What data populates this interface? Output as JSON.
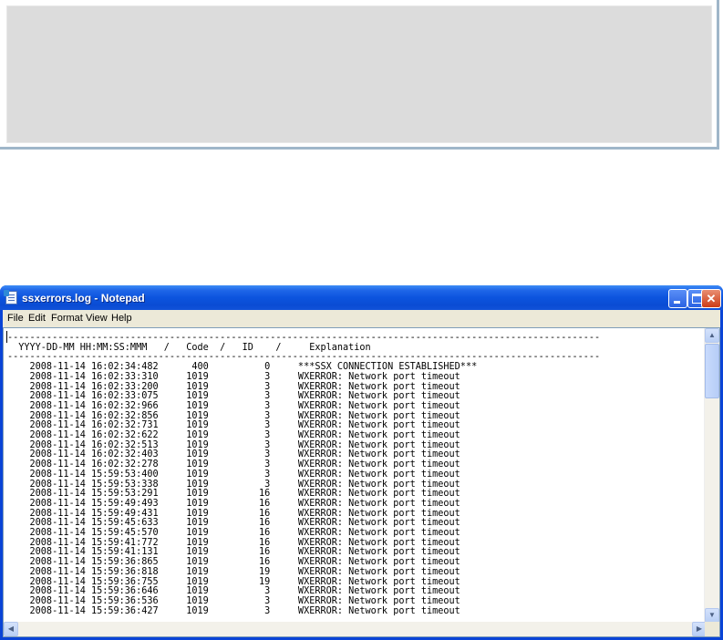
{
  "window": {
    "title": "ssxerrors.log - Notepad",
    "min_glyph": "",
    "max_glyph": "",
    "close_glyph": "✕"
  },
  "menu": [
    "File",
    "Edit",
    "Format",
    "View",
    "Help"
  ],
  "log": {
    "separator": "----------------------------------------------------------------------------------------------------------",
    "header": "  YYYY-DD-MM HH:MM:SS:MMM   /   Code  /   ID    /     Explanation",
    "rows": [
      [
        "2008-11-14",
        "16:02:34:482",
        "400",
        "0",
        "***SSX CONNECTION ESTABLISHED***"
      ],
      [
        "2008-11-14",
        "16:02:33:310",
        "1019",
        "3",
        "WXERROR: Network port timeout"
      ],
      [
        "2008-11-14",
        "16:02:33:200",
        "1019",
        "3",
        "WXERROR: Network port timeout"
      ],
      [
        "2008-11-14",
        "16:02:33:075",
        "1019",
        "3",
        "WXERROR: Network port timeout"
      ],
      [
        "2008-11-14",
        "16:02:32:966",
        "1019",
        "3",
        "WXERROR: Network port timeout"
      ],
      [
        "2008-11-14",
        "16:02:32:856",
        "1019",
        "3",
        "WXERROR: Network port timeout"
      ],
      [
        "2008-11-14",
        "16:02:32:731",
        "1019",
        "3",
        "WXERROR: Network port timeout"
      ],
      [
        "2008-11-14",
        "16:02:32:622",
        "1019",
        "3",
        "WXERROR: Network port timeout"
      ],
      [
        "2008-11-14",
        "16:02:32:513",
        "1019",
        "3",
        "WXERROR: Network port timeout"
      ],
      [
        "2008-11-14",
        "16:02:32:403",
        "1019",
        "3",
        "WXERROR: Network port timeout"
      ],
      [
        "2008-11-14",
        "16:02:32:278",
        "1019",
        "3",
        "WXERROR: Network port timeout"
      ],
      [
        "2008-11-14",
        "15:59:53:400",
        "1019",
        "3",
        "WXERROR: Network port timeout"
      ],
      [
        "2008-11-14",
        "15:59:53:338",
        "1019",
        "3",
        "WXERROR: Network port timeout"
      ],
      [
        "2008-11-14",
        "15:59:53:291",
        "1019",
        "16",
        "WXERROR: Network port timeout"
      ],
      [
        "2008-11-14",
        "15:59:49:493",
        "1019",
        "16",
        "WXERROR: Network port timeout"
      ],
      [
        "2008-11-14",
        "15:59:49:431",
        "1019",
        "16",
        "WXERROR: Network port timeout"
      ],
      [
        "2008-11-14",
        "15:59:45:633",
        "1019",
        "16",
        "WXERROR: Network port timeout"
      ],
      [
        "2008-11-14",
        "15:59:45:570",
        "1019",
        "16",
        "WXERROR: Network port timeout"
      ],
      [
        "2008-11-14",
        "15:59:41:772",
        "1019",
        "16",
        "WXERROR: Network port timeout"
      ],
      [
        "2008-11-14",
        "15:59:41:131",
        "1019",
        "16",
        "WXERROR: Network port timeout"
      ],
      [
        "2008-11-14",
        "15:59:36:865",
        "1019",
        "16",
        "WXERROR: Network port timeout"
      ],
      [
        "2008-11-14",
        "15:59:36:818",
        "1019",
        "19",
        "WXERROR: Network port timeout"
      ],
      [
        "2008-11-14",
        "15:59:36:755",
        "1019",
        "19",
        "WXERROR: Network port timeout"
      ],
      [
        "2008-11-14",
        "15:59:36:646",
        "1019",
        "3",
        "WXERROR: Network port timeout"
      ],
      [
        "2008-11-14",
        "15:59:36:536",
        "1019",
        "3",
        "WXERROR: Network port timeout"
      ],
      [
        "2008-11-14",
        "15:59:36:427",
        "1019",
        "3",
        "WXERROR: Network port timeout"
      ]
    ]
  },
  "scrollbar": {
    "up_arrow": "▲",
    "down_arrow": "▼",
    "left_arrow": "◀",
    "right_arrow": "▶",
    "vertical_position": 0.0
  }
}
